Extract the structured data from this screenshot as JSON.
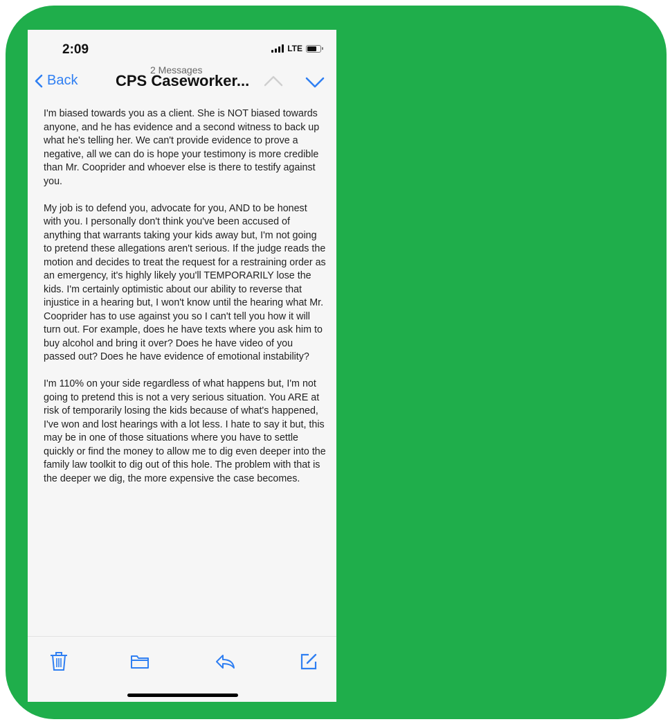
{
  "status_bar": {
    "time": "2:09",
    "network": "LTE"
  },
  "nav": {
    "back_label": "Back",
    "message_count": "2 Messages",
    "title": "CPS Caseworker...",
    "accent_color": "#2f7ff2"
  },
  "email": {
    "paragraphs": [
      "I'm biased towards you as a client. She is NOT biased towards anyone, and he has evidence and a second witness to back up what he's telling her. We can't provide evidence to prove a negative, all we can do is hope your testimony is more credible than Mr. Cooprider and whoever else is there to testify against you.",
      "My job is to defend you, advocate for you, AND to be honest with you. I personally don't think you've been accused of anything that warrants taking your kids away but, I'm not going to pretend these allegations aren't serious. If the judge reads the motion and decides to treat the request for a restraining order as an emergency, it's highly likely you'll TEMPORARILY lose the kids. I'm certainly optimistic about our ability to reverse that injustice in a hearing but, I won't know until the hearing what Mr. Cooprider has to use against you so I can't tell you how it will turn out. For example, does he have texts where you ask him to buy alcohol and bring it over? Does he have video of you passed out? Does he have evidence of emotional instability?",
      "I'm 110% on your side regardless of what happens but, I'm not going to pretend this is not a very serious situation. You ARE at risk of temporarily losing the kids because of what's happened, I've won and lost hearings with a lot less. I hate to say it but, this may be in one of those situations where you have to settle quickly or find the money to allow me to dig even deeper into the family law toolkit to dig out of this hole. The problem with that is the deeper we dig, the more expensive the case becomes."
    ]
  },
  "toolbar": {
    "icons": [
      "trash-icon",
      "folder-icon",
      "reply-icon",
      "compose-icon"
    ]
  },
  "colors": {
    "background_frame": "#1fae4b",
    "screen": "#f6f6f6"
  }
}
